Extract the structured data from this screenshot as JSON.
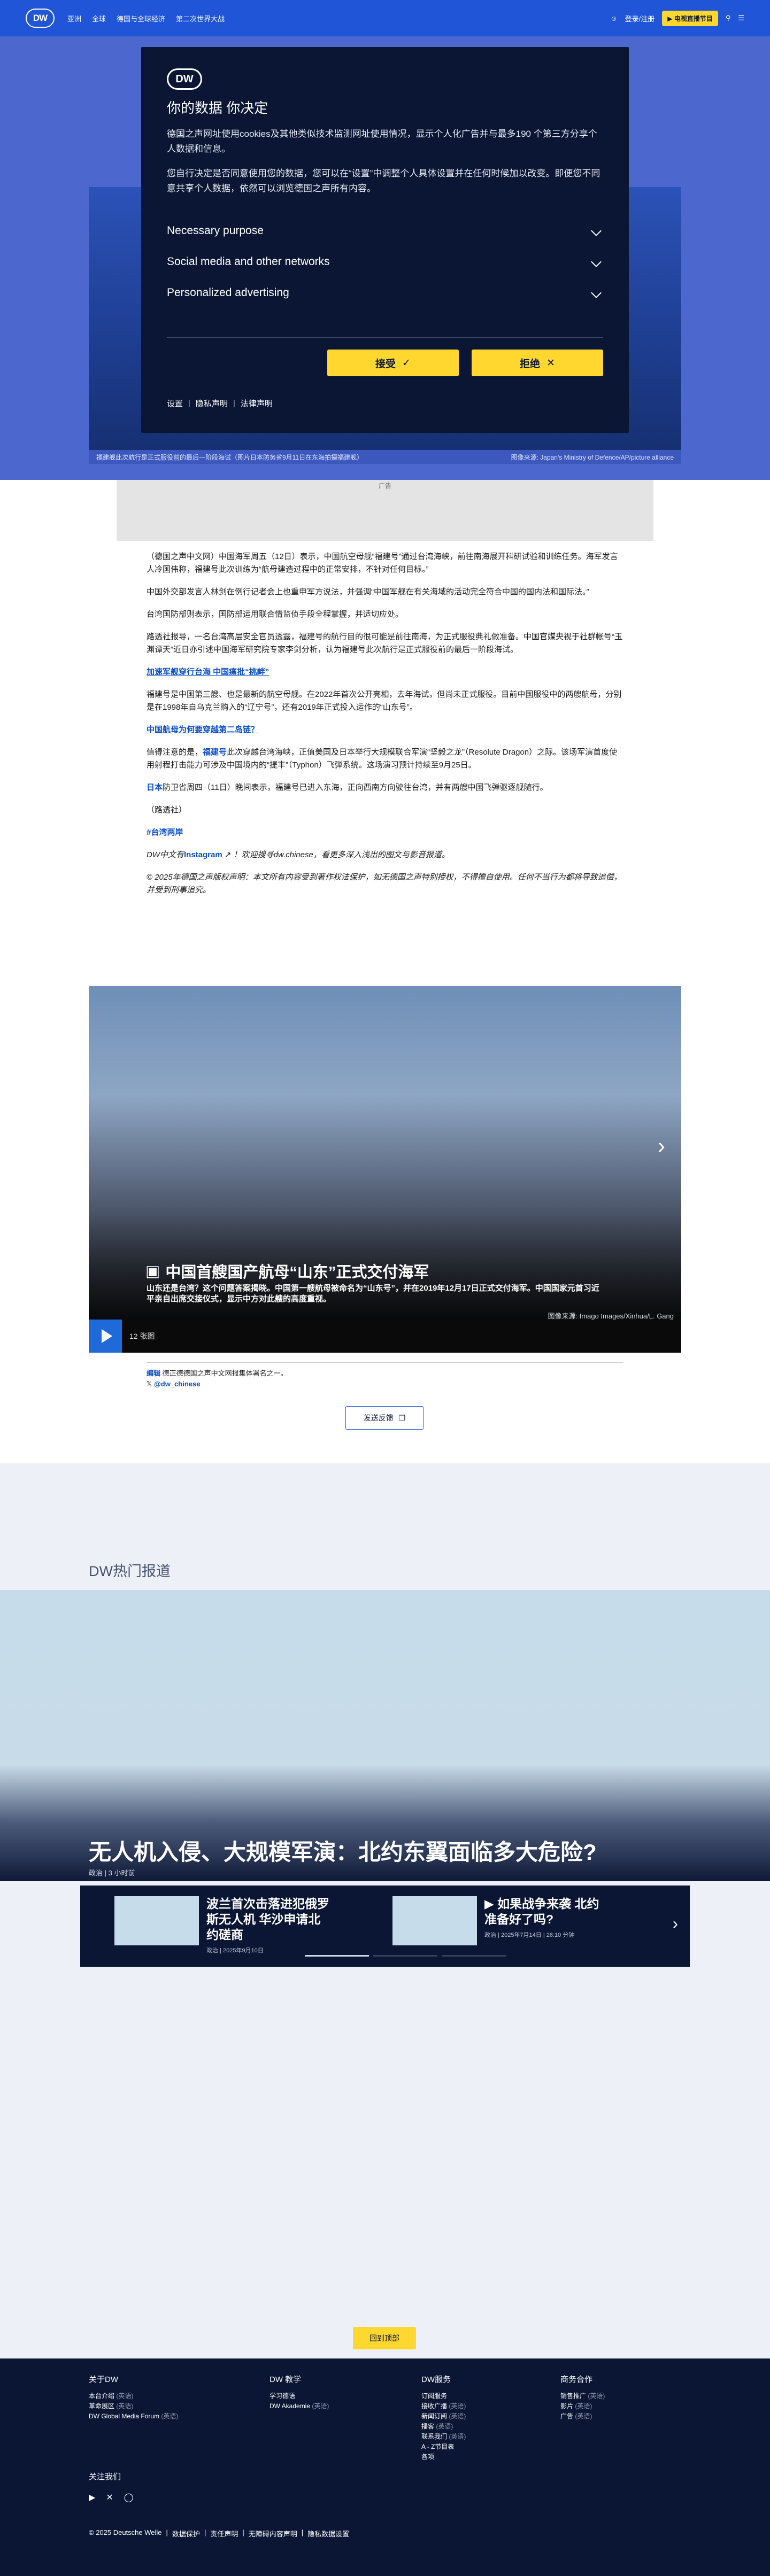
{
  "header": {
    "logo": "DW",
    "nav": [
      "亚洲",
      "全球",
      "德国与全球经济",
      "第二次世界大战"
    ],
    "login": "登录/注册",
    "live_label": "电视直播节目",
    "icons": [
      "search-icon",
      "user-icon",
      "menu-icon"
    ]
  },
  "hero": {
    "caption": "福建舰此次航行是正式服役前的最后一阶段海试（图片日本防务省9月11日在东海拍摄福建舰）",
    "credit": "图像来源: Japan's Ministry of Defence/AP/picture alliance",
    "ad_label": "广告"
  },
  "consent": {
    "logo": "DW",
    "title": "你的数据 你决定",
    "p1": "德国之声网址使用cookies及其他类似技术监测网址使用情况，显示个人化广告并与最多190 个第三方分享个人数据和信息。",
    "p2": "您自行决定是否同意使用您的数据，您可以在“设置”中调整个人具体设置并在任何时候加以改变。即便您不同意共享个人数据，依然可以浏览德国之声所有内容。",
    "options": [
      "Necessary purpose",
      "Social media and other networks",
      "Personalized advertising"
    ],
    "accept": "接受",
    "reject": "拒绝",
    "links": [
      "设置",
      "隐私声明",
      "法律声明"
    ]
  },
  "article": {
    "p1": "（德国之声中文网）中国海军周五（12日）表示，中国航空母舰“福建号”通过台湾海峡，前往南海展开科研试验和训练任务。海军发言人冷国伟称，福建号此次训练为“航母建造过程中的正常安排，不针对任何目标。”",
    "p2": "中国外交部发言人林剑在例行记者会上也重申军方说法，并强调“中国军舰在有关海域的活动完全符合中国的国内法和国际法。”",
    "p3": "台湾国防部则表示，国防部运用联合情监侦手段全程掌握，并适切应处。",
    "p4": "路透社报导，一名台湾高层安全官员透露，福建号的航行目的很可能是前往南海，为正式服役典礼做准备。中国官媒央视于社群帐号“玉渊谭天”近日亦引述中国海军研究院专家李剑分析，认为福建号此次航行是正式服役前的最后一阶段海试。",
    "sub1": "加速军舰穿行台海 中国痛批“挑衅”",
    "p5": "福建号是中国第三艘、也是最新的航空母舰。在2022年首次公开亮相，去年海试，但尚未正式服役。目前中国服役中的两艘航母，分别是在1998年自乌克兰购入的“辽宁号”，还有2019年正式投入运作的“山东号”。",
    "sub2": "中国航母为何要穿越第二岛链？",
    "p6a": "值得注意的是，",
    "p6link": "福建号",
    "p6b": "此次穿越台湾海峡，正值美国及日本举行大规模联合军演“坚毅之龙”（Resolute Dragon）之际。该场军演首度使用射程打击能力可涉及中国境内的“提丰”（Typhon）飞弹系统。这场演习预计持续至9月25日。",
    "p7a": "日本",
    "p7b": "防卫省周四（11日）晚间表示，福建号已进入东海，正向西南方向驶往台湾，并有两艘中国飞弹驱逐舰随行。",
    "source": "（路透社）",
    "tag": "#台湾两岸",
    "ig_a": "DW中文有",
    "ig_link": "Instagram",
    "ig_b": "！欢迎搜寻dw.chinese，看更多深入浅出的图文与影音报道。",
    "copyright": "© 2025年德国之声版权声明：本文所有内容受到著作权法保护，如无德国之声特别授权，不得擅自使用。任何不当行为都将导致追偿，并受到刑事追究。"
  },
  "gallery": {
    "title": "中国首艘国产航母“山东”正式交付海军",
    "desc": "山东还是台湾？这个问题答案揭晓。中国第一艘航母被命名为“山东号”，并在2019年12月17日正式交付海军。中国国家元首习近平亲自出席交接仪式，显示中方对此艘的高度重视。",
    "credit": "图像来源: Imago Images/Xinhua/L. Gang",
    "count": "12 张图"
  },
  "editor": {
    "name": "编辑",
    "note": "德正德德国之声中文网报集体署名之一。",
    "handle": "@dw_chinese"
  },
  "feedback": "发送反馈",
  "hot": {
    "label": "DW热门报道",
    "title": "无人机入侵、大规模军演：北约东翼面临多大危险?",
    "meta": "政治 | 3 小时前",
    "cards": [
      {
        "title": "波兰首次击落进犯俄罗斯无人机 华沙申请北约磋商",
        "meta": "政治 | 2025年9月10日"
      },
      {
        "title": "如果战争来袭 北约准备好了吗?",
        "meta": "政治 | 2025年7月14日 | 26:10 分钟"
      }
    ]
  },
  "gotop": "回到顶部",
  "footer": {
    "cols": [
      {
        "title": "关于DW",
        "items": [
          {
            "t": "本台介绍",
            "s": "(英语)"
          },
          {
            "t": "革命展区",
            "s": "(英语)"
          },
          {
            "t": "DW Global Media Forum",
            "s": "(英语)"
          }
        ]
      },
      {
        "title": "DW 教学",
        "items": [
          {
            "t": "学习德语",
            "s": ""
          },
          {
            "t": "DW Akademie",
            "s": "(英语)"
          }
        ]
      },
      {
        "title": "DW服务",
        "items": [
          {
            "t": "订阅服务",
            "s": ""
          },
          {
            "t": "接收广播",
            "s": "(英语)"
          },
          {
            "t": "新闻订阅",
            "s": "(英语)"
          },
          {
            "t": "播客",
            "s": "(英语)"
          },
          {
            "t": "联系我们",
            "s": "(英语)"
          },
          {
            "t": "A - Z节目表",
            "s": ""
          },
          {
            "t": "各项",
            "s": ""
          }
        ]
      },
      {
        "title": "商务合作",
        "items": [
          {
            "t": "销售推广",
            "s": "(英语)"
          },
          {
            "t": "影片",
            "s": "(英语)"
          },
          {
            "t": "广告",
            "s": "(英语)"
          }
        ]
      }
    ],
    "follow": "关注我们",
    "social": [
      "youtube-icon",
      "x-icon",
      "instagram-icon"
    ],
    "links": [
      "© 2025 Deutsche Welle",
      "数据保护",
      "责任声明",
      "无障碍内容声明",
      "隐私数据设置"
    ]
  }
}
